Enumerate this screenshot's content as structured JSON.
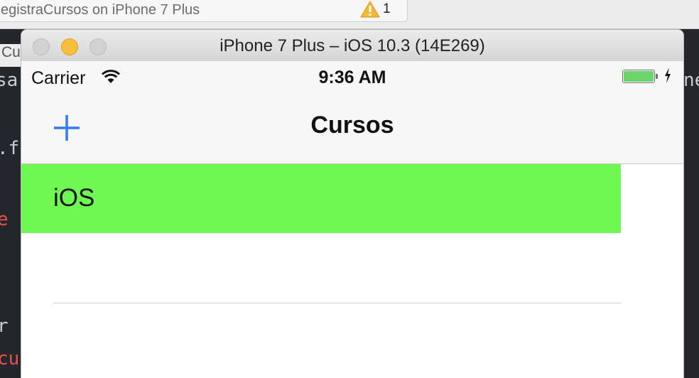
{
  "xcode": {
    "activity_text": "egistraCursos on iPhone 7 Plus",
    "warning_count": "1",
    "tab_fragment": "Cu",
    "code_fragments": [
      ".fo",
      "e",
      "r s",
      "cu",
      "sa",
      "ne"
    ]
  },
  "simulator": {
    "window_title": "iPhone 7 Plus – iOS 10.3 (14E269)"
  },
  "status_bar": {
    "carrier": "Carrier",
    "time": "9:36 AM",
    "battery_level": 1.0
  },
  "nav_bar": {
    "title": "Cursos",
    "add_button_icon": "plus-icon"
  },
  "table": {
    "rows": [
      {
        "label": "iOS",
        "selected": true
      },
      {
        "label": "",
        "selected": false
      }
    ]
  },
  "colors": {
    "tint": "#2f7bf5",
    "selection": "#6ef851",
    "battery": "#6bd46a"
  }
}
